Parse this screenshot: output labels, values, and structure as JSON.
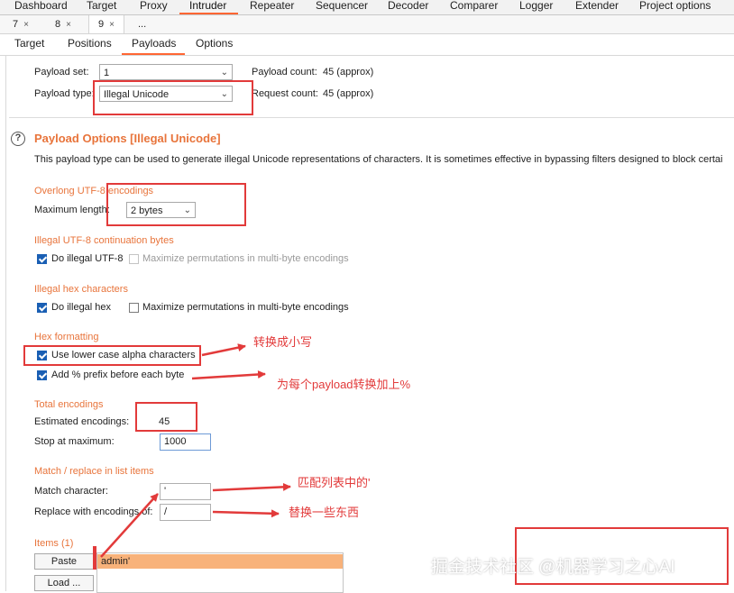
{
  "main_tabs": [
    "Dashboard",
    "Target",
    "Proxy",
    "Intruder",
    "Repeater",
    "Sequencer",
    "Decoder",
    "Comparer",
    "Logger",
    "Extender",
    "Project options"
  ],
  "attack_tabs": [
    {
      "label": "7",
      "close": "×"
    },
    {
      "label": "8",
      "close": "×"
    },
    {
      "label": "9",
      "close": "×"
    },
    {
      "label": "..."
    }
  ],
  "sub_tabs": [
    "Target",
    "Positions",
    "Payloads",
    "Options"
  ],
  "payload_sets": {
    "set_label": "Payload set:",
    "set_value": "1",
    "type_label": "Payload type:",
    "type_value": "Illegal Unicode",
    "count_label": "Payload count:",
    "count_value": "45 (approx)",
    "request_label": "Request count:",
    "request_value": "45 (approx)"
  },
  "options": {
    "title": "Payload Options [Illegal Unicode]",
    "description": "This payload type can be used to generate illegal Unicode representations of characters. It is sometimes effective in bypassing filters designed to block certai",
    "overlong": {
      "heading": "Overlong UTF-8 encodings",
      "max_length_label": "Maximum length:",
      "max_length_value": "2 bytes"
    },
    "continuation": {
      "heading": "Illegal UTF-8 continuation bytes",
      "do_illegal_utf8": "Do illegal UTF-8",
      "maximize_label": "Maximize permutations in multi-byte encodings"
    },
    "hex_chars": {
      "heading": "Illegal hex characters",
      "do_illegal_hex": "Do illegal hex",
      "maximize_label": "Maximize permutations in multi-byte encodings"
    },
    "hex_format": {
      "heading": "Hex formatting",
      "lower_case": "Use lower case alpha characters",
      "add_prefix": "Add % prefix before each byte"
    },
    "total": {
      "heading": "Total encodings",
      "estimated_label": "Estimated encodings:",
      "estimated_value": "45",
      "stop_label": "Stop at maximum:",
      "stop_value": "1000"
    },
    "match_replace": {
      "heading": "Match / replace in list items",
      "match_label": "Match character:",
      "match_value": "'",
      "replace_label": "Replace with encodings of:",
      "replace_value": "/"
    },
    "items": {
      "heading": "Items (1)",
      "paste": "Paste",
      "load": "Load ...",
      "list": [
        "admin'"
      ]
    }
  },
  "annotations": {
    "lowercase": "转换成小写",
    "prefix": "为每个payload转换加上%",
    "match": "匹配列表中的'",
    "replace": "替换一些东西"
  },
  "watermark": "掘金技术社区 @机器学习之心AI",
  "colors": {
    "accent": "#ff6633",
    "section_heading": "#e8743b",
    "annotation": "#e23a3a",
    "selected_row": "#f8b27a",
    "checkbox": "#1a5fb4"
  }
}
